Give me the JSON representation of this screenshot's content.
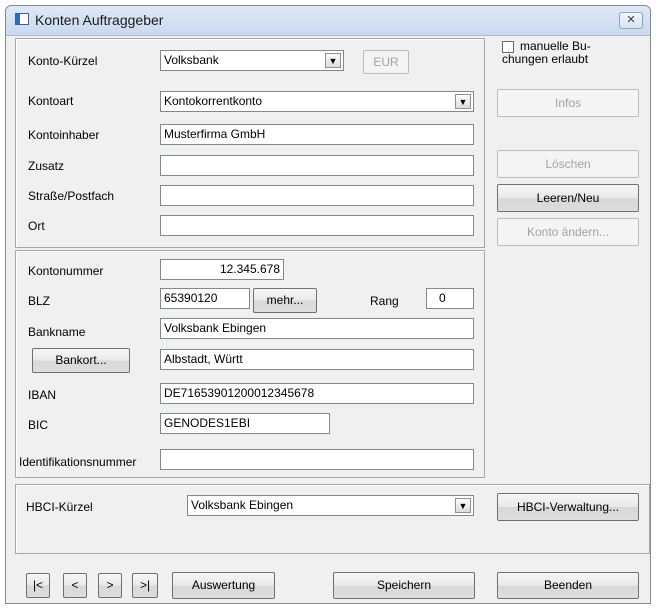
{
  "window": {
    "title": "Konten Auftraggeber",
    "close_label": "✕"
  },
  "account": {
    "kuerzel_label": "Konto-Kürzel",
    "kuerzel_value": "Volksbank",
    "currency_button": "EUR",
    "kontoart_label": "Kontoart",
    "kontoart_value": "Kontokorrentkonto",
    "inhaber_label": "Kontoinhaber",
    "inhaber_value": "Musterfirma GmbH",
    "zusatz_label": "Zusatz",
    "zusatz_value": "",
    "strasse_label": "Straße/Postfach",
    "strasse_value": "",
    "ort_label": "Ort",
    "ort_value": ""
  },
  "bank": {
    "kontonummer_label": "Kontonummer",
    "kontonummer_value": "12.345.678",
    "blz_label": "BLZ",
    "blz_value": "65390120",
    "mehr_button": "mehr...",
    "rang_label": "Rang",
    "rang_value": "0",
    "bankname_label": "Bankname",
    "bankname_value": "Volksbank Ebingen",
    "bankort_button": "Bankort...",
    "bankort_value": "Albstadt, Württ",
    "iban_label": "IBAN",
    "iban_value": "DE71653901200012345678",
    "bic_label": "BIC",
    "bic_value": "GENODES1EBI",
    "ident_label": "Identifikationsnummer",
    "ident_value": ""
  },
  "side": {
    "manual_label": "manuelle Bu-\nchungen erlaubt",
    "infos": "Infos",
    "loeschen": "Löschen",
    "leeren": "Leeren/Neu",
    "konto_aendern": "Konto ändern..."
  },
  "hbci": {
    "label": "HBCI-Kürzel",
    "value": "Volksbank Ebingen",
    "verwaltung_button": "HBCI-Verwaltung..."
  },
  "footer": {
    "first": "|<",
    "prev": "<",
    "next": ">",
    "last": ">|",
    "auswertung": "Auswertung",
    "speichern": "Speichern",
    "beenden": "Beenden"
  }
}
